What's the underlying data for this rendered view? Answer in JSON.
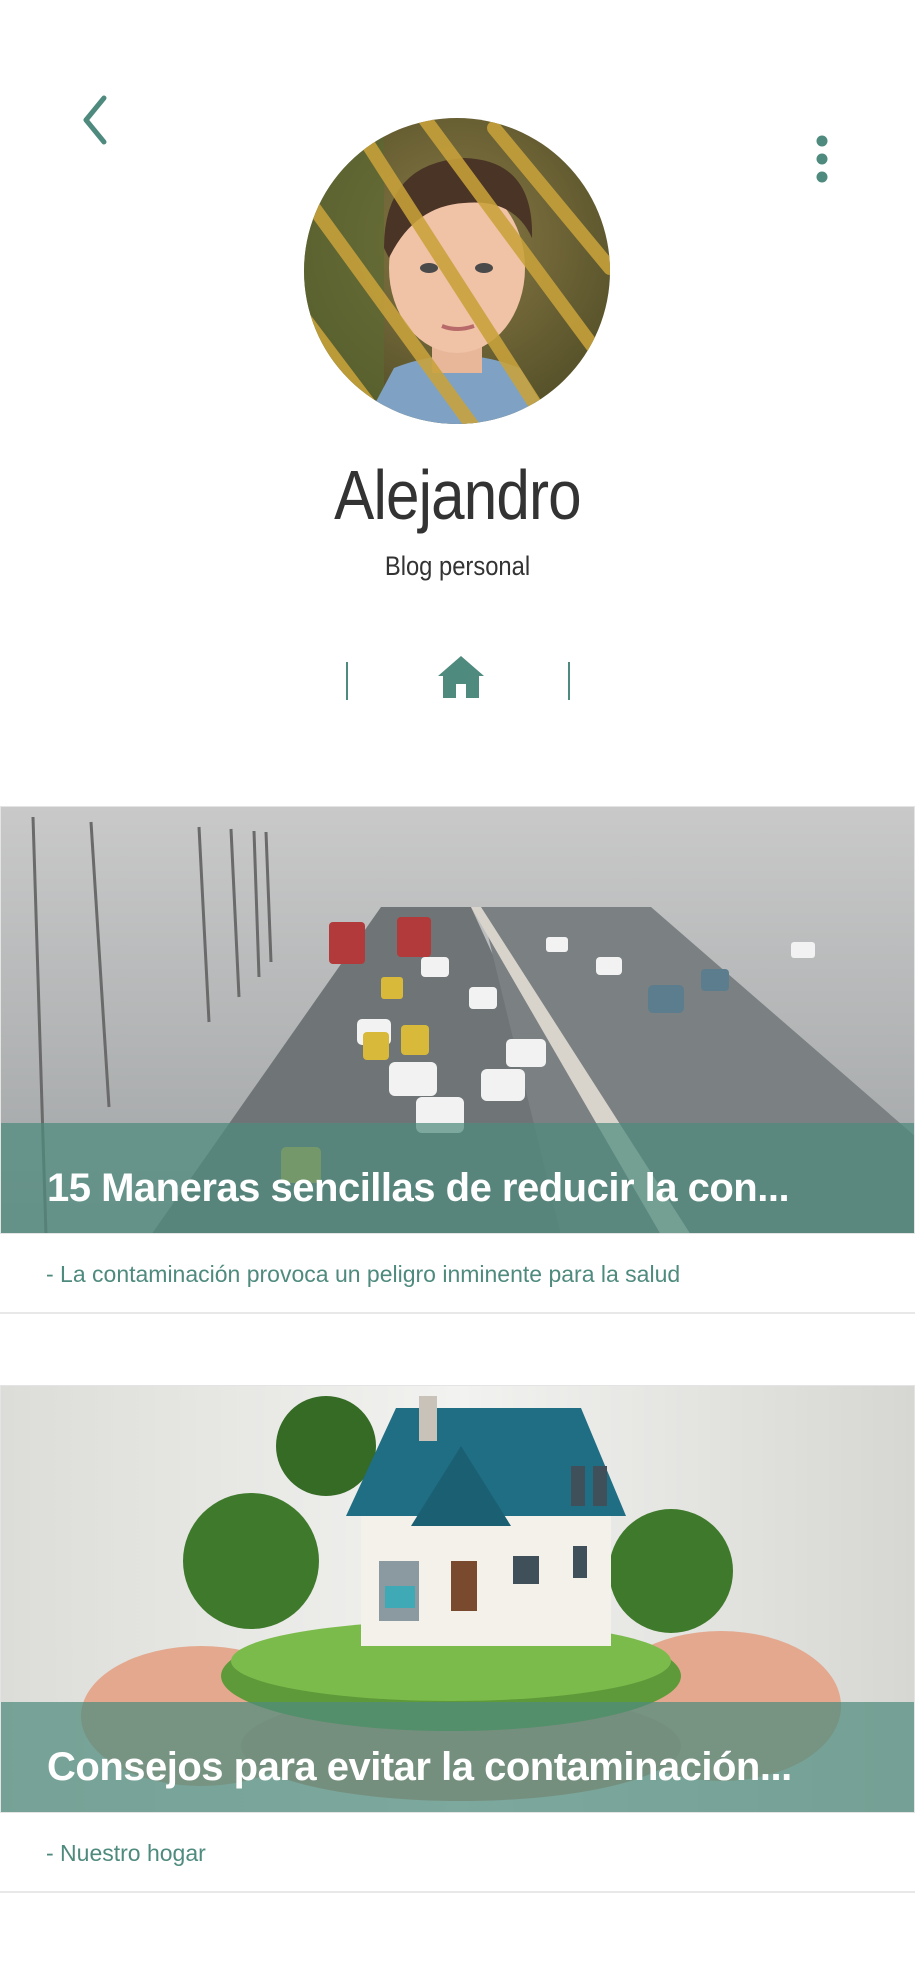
{
  "header": {
    "back_icon": "chevron-left-icon",
    "more_icon": "vertical-dots-icon"
  },
  "profile": {
    "name": "Alejandro",
    "subtitle": "Blog personal",
    "avatar": "profile-photo"
  },
  "tabs": {
    "home_icon": "home-icon",
    "accent_color": "#4e8a7d"
  },
  "posts": [
    {
      "title": "15 Maneras sencillas de reducir la con...",
      "description": "- La contaminación provoca un peligro inminente para la salud",
      "image": "highway-smog-photo"
    },
    {
      "title": "Consejos para evitar la contaminación...",
      "description": "- Nuestro hogar",
      "image": "house-in-hands-photo"
    }
  ]
}
